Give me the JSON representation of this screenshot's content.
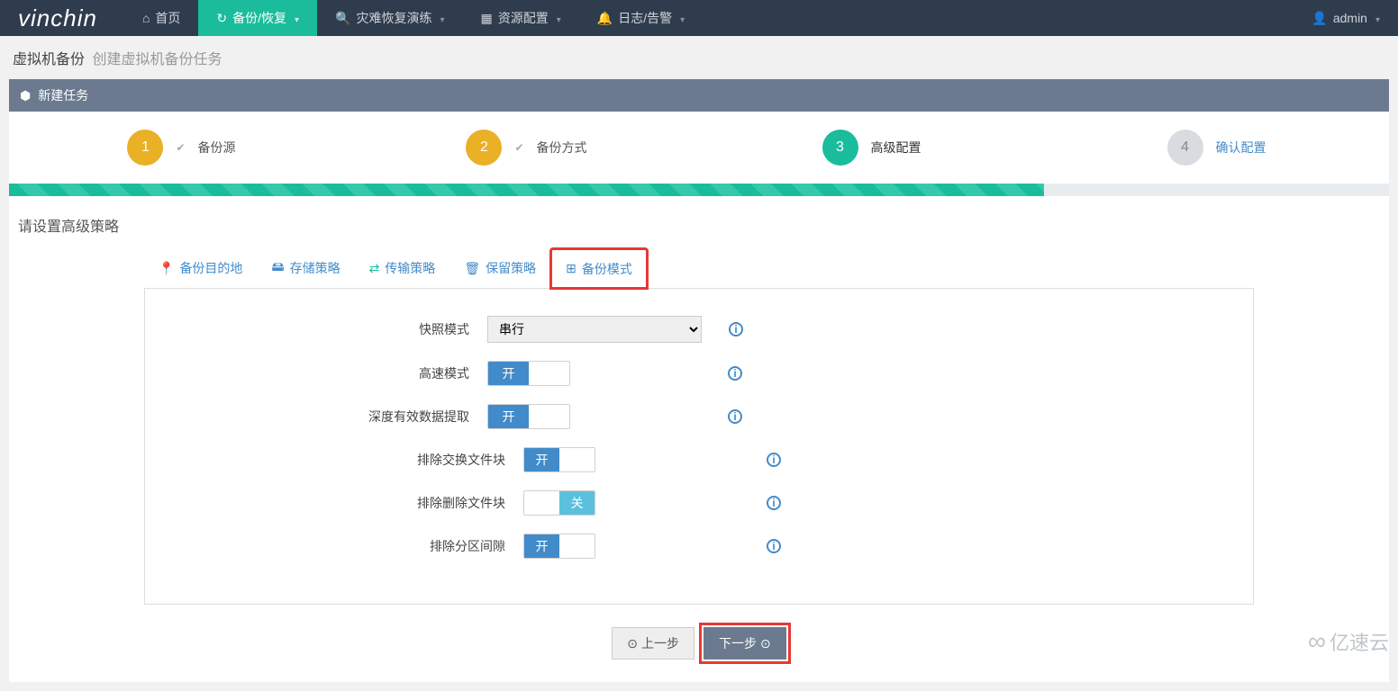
{
  "brand": "vinchin",
  "nav": {
    "home": "首页",
    "backup": "备份/恢复",
    "drill": "灾难恢复演练",
    "resource": "资源配置",
    "log": "日志/告警"
  },
  "user": {
    "name": "admin"
  },
  "breadcrumb": {
    "main": "虚拟机备份",
    "sub": "创建虚拟机备份任务"
  },
  "panel": {
    "title": "新建任务"
  },
  "steps": {
    "s1": {
      "num": "1",
      "label": "备份源"
    },
    "s2": {
      "num": "2",
      "label": "备份方式"
    },
    "s3": {
      "num": "3",
      "label": "高级配置"
    },
    "s4": {
      "num": "4",
      "label": "确认配置"
    }
  },
  "prompt": "请设置高级策略",
  "tabs": {
    "dest": "备份目的地",
    "storage": "存储策略",
    "transfer": "传输策略",
    "retain": "保留策略",
    "mode": "备份模式"
  },
  "form": {
    "snapshot": {
      "label": "快照模式",
      "value": "串行"
    },
    "speed": {
      "label": "高速模式"
    },
    "deep": {
      "label": "深度有效数据提取"
    },
    "swap": {
      "label": "排除交换文件块"
    },
    "deleted": {
      "label": "排除删除文件块"
    },
    "partition": {
      "label": "排除分区间隙"
    },
    "toggle_on": "开",
    "toggle_off": "关"
  },
  "actions": {
    "prev": "上一步",
    "next": "下一步"
  },
  "watermark": "亿速云"
}
